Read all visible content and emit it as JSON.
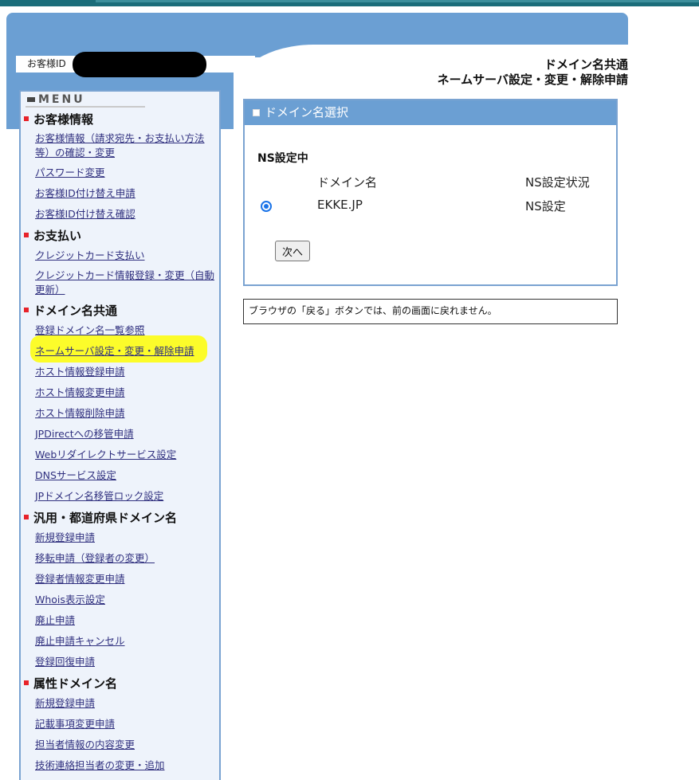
{
  "header": {
    "customer_id_label": "お客様ID",
    "title_line1": "ドメイン名共通",
    "title_line2": "ネームサーバ設定・変更・解除申請"
  },
  "menu": {
    "heading": "MENU",
    "sections": [
      {
        "label": "お客様情報",
        "items": [
          "お客様情報（請求宛先・お支払い方法等）の確認・変更",
          "パスワード変更",
          "お客様ID付け替え申請",
          "お客様ID付け替え確認"
        ]
      },
      {
        "label": "お支払い",
        "items": [
          "クレジットカード支払い",
          "クレジットカード情報登録・変更（自動更新）"
        ]
      },
      {
        "label": "ドメイン名共通",
        "items": [
          "登録ドメイン名一覧参照",
          "ネームサーバ設定・変更・解除申請",
          "ホスト情報登録申請",
          "ホスト情報変更申請",
          "ホスト情報削除申請",
          "JPDirectへの移管申請",
          "Webリダイレクトサービス設定",
          "DNSサービス設定",
          "JPドメイン名移管ロック設定"
        ]
      },
      {
        "label": "汎用・都道府県ドメイン名",
        "items": [
          "新規登録申請",
          "移転申請（登録者の変更）",
          "登録者情報変更申請",
          "Whois表示設定",
          "廃止申請",
          "廃止申請キャンセル",
          "登録回復申請"
        ]
      },
      {
        "label": "属性ドメイン名",
        "items": [
          "新規登録申請",
          "記載事項変更申請",
          "担当者情報の内容変更",
          "技術連絡担当者の変更・追加"
        ]
      }
    ]
  },
  "panel": {
    "title": "ドメイン名選択",
    "ns_label": "NS設定中",
    "col_domain": "ドメイン名",
    "col_status": "NS設定状況",
    "row": {
      "domain": "EKKE.JP",
      "status": "NS設定",
      "selected": true
    },
    "next_button": "次へ"
  },
  "notice": "ブラウザの「戻る」ボタンでは、前の画面に戻れません。",
  "colors": {
    "accent": "#6b9fd3",
    "topbar": "#1b6d7a",
    "highlight": "#fcfc2a",
    "link": "#30307f",
    "bullet": "#e8232a"
  }
}
